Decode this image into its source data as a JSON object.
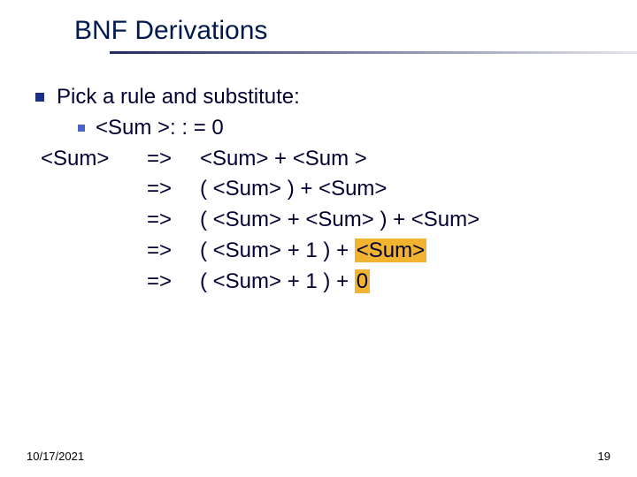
{
  "title": "BNF Derivations",
  "lead_in": "Pick a rule and substitute:",
  "rule": "<Sum >: : = 0",
  "deriv": {
    "start": "<Sum>",
    "arrow": "=>",
    "line1": "<Sum> + <Sum >",
    "line2": "( <Sum> ) + <Sum>",
    "line3": "( <Sum> + <Sum> ) + <Sum>",
    "line4_a": "( <Sum> + 1 ) + ",
    "line4_hl": "<Sum>",
    "line5_a": "( <Sum> + 1 ) + ",
    "line5_hl": "0"
  },
  "footer": {
    "date": "10/17/2021",
    "page": "19"
  }
}
